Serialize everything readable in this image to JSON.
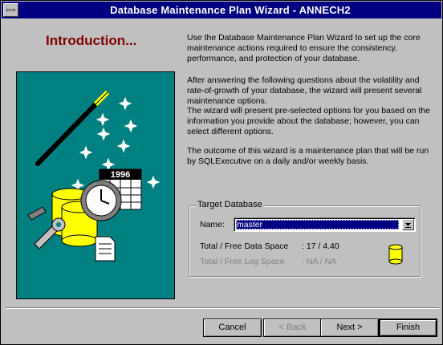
{
  "window": {
    "title": "Database Maintenance Plan Wizard - ANNECH2"
  },
  "intro": {
    "heading": "Introduction..."
  },
  "art": {
    "calendar_year": "1996"
  },
  "description": {
    "p1": "Use the Database Maintenance Plan Wizard to set up the core maintenance actions required to ensure the consistency, performance, and protection of your database.",
    "p2": "After answering the following questions about the volatility and rate-of-growth of your database, the wizard will present several maintenance options.",
    "p3": "The wizard will present pre-selected options for you based on the information you provide about the database; however, you can select different options.",
    "p4": "The outcome of this wizard is a maintenance plan that will be run by SQLExecutive on a daily and/or weekly basis."
  },
  "target": {
    "legend": "Target Database",
    "name_label": "Name:",
    "name_value": "master",
    "data_space_label": "Total / Free Data Space",
    "data_space_value": ": 17 / 4.40",
    "log_space_label": "Total / Free Log Space",
    "log_space_value": ": NA / NA"
  },
  "buttons": {
    "cancel": "Cancel",
    "back": "< Back",
    "next": "Next >",
    "finish": "Finish"
  },
  "colors": {
    "titlebar": "#000080",
    "heading": "#800000",
    "art_bg": "#008080",
    "db_icon": "#ffff00"
  }
}
